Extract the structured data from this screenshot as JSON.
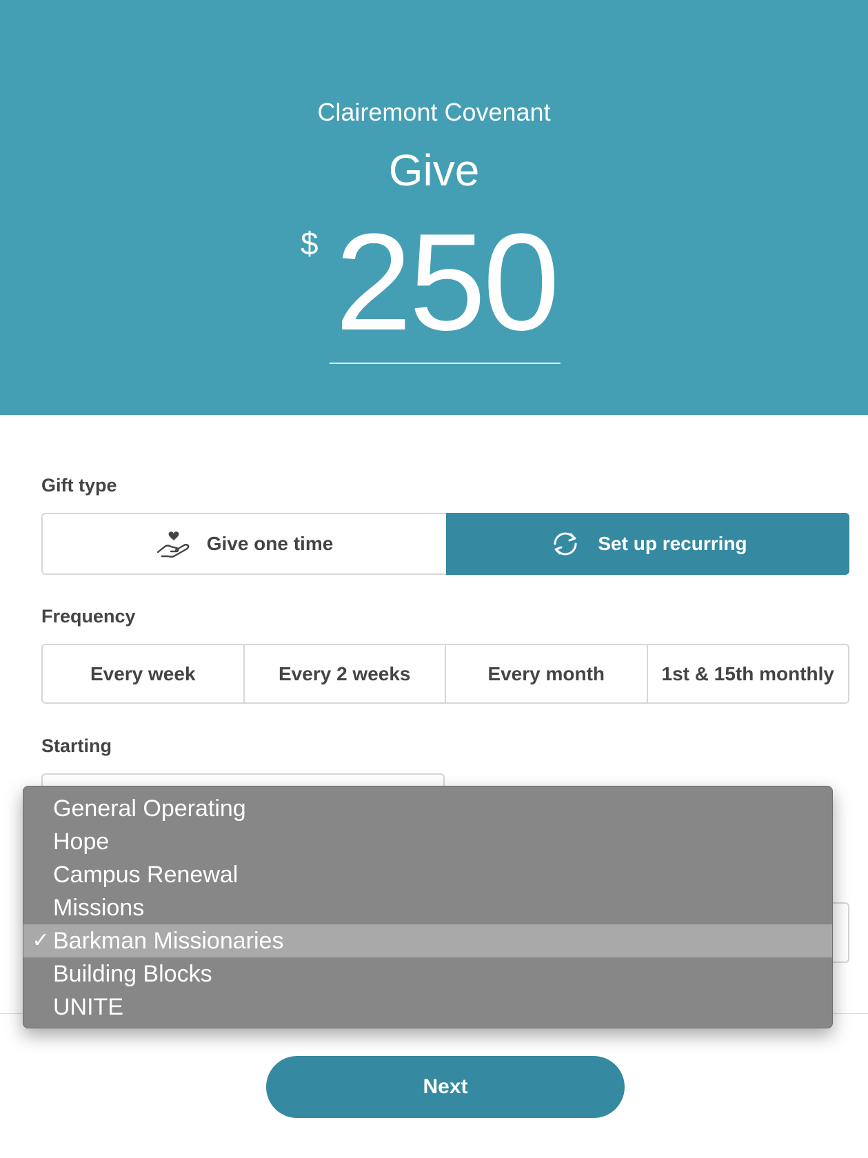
{
  "header": {
    "organization": "Clairemont Covenant",
    "title": "Give",
    "currency_symbol": "$",
    "amount": "250"
  },
  "gift_type": {
    "label": "Gift type",
    "options": [
      {
        "label": "Give one time",
        "icon": "hand-heart-icon",
        "selected": false
      },
      {
        "label": "Set up recurring",
        "icon": "refresh-icon",
        "selected": true
      }
    ]
  },
  "frequency": {
    "label": "Frequency",
    "options": [
      "Every week",
      "Every 2 weeks",
      "Every month",
      "1st & 15th monthly"
    ]
  },
  "starting": {
    "label": "Starting"
  },
  "fund_dropdown": {
    "selected_marker": "✓",
    "selected": "Barkman Missionaries",
    "options": [
      "General Operating",
      "Hope",
      "Campus Renewal",
      "Missions",
      "Barkman Missionaries",
      "Building Blocks",
      "UNITE"
    ]
  },
  "actions": {
    "next_label": "Next"
  },
  "colors": {
    "hero": "#449fb5",
    "accent": "#3589a0",
    "dropdown_bg": "#878787",
    "dropdown_selected": "#a9a9a9"
  }
}
